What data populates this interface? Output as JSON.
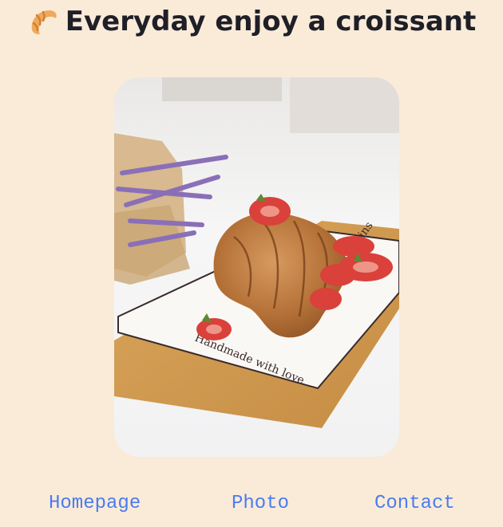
{
  "header": {
    "icon": "croissant-icon",
    "title": "Everyday enjoy a croissant"
  },
  "photo": {
    "subject": "croissant-photo"
  },
  "nav": {
    "items": [
      {
        "label": "Homepage"
      },
      {
        "label": "Photo"
      },
      {
        "label": "Contact"
      }
    ]
  },
  "colors": {
    "background": "#faebd9",
    "title": "#1f1f28",
    "link": "#4a7cf0",
    "croissant_icon": "#f0a85a"
  }
}
